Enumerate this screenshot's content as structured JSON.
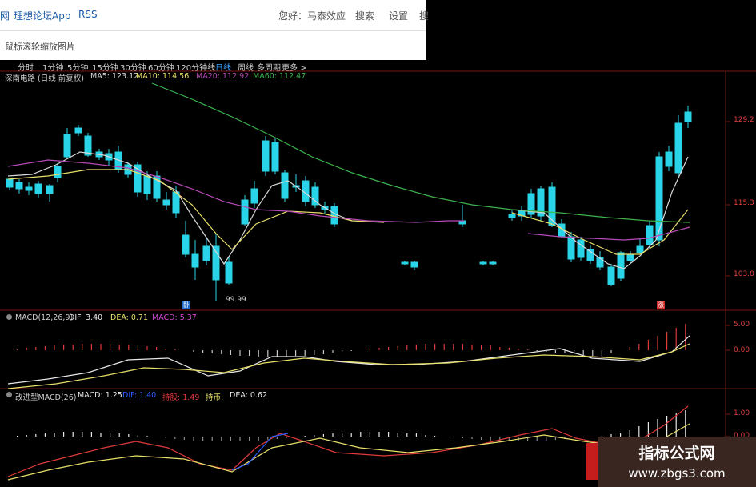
{
  "topbar": {
    "cut_left": "网",
    "forum_app": "理想论坛App",
    "rss": "RSS",
    "greeting": "您好：马泰效应",
    "search": "搜索",
    "settings": "设置",
    "cut_right": "搜"
  },
  "hint": "鼠标滚轮缩放图片",
  "periods": [
    "分时",
    "1分钟",
    "5分钟",
    "15分钟",
    "30分钟",
    "60分钟",
    "120分钟线",
    "日线",
    "周线",
    "多周期",
    "更多 >"
  ],
  "active_period": "日线",
  "ma": {
    "stock": "深南电路 (日线 前复权)",
    "ma5": "MA5: 123.12",
    "ma10": "MA10: 114.56",
    "ma20": "MA20: 112.92",
    "ma60": "MA60: 112.47",
    "arrow": "↑"
  },
  "price_ticks": [
    "129.2",
    "115.3",
    "103.8"
  ],
  "low_label": "99.99",
  "marker_left": "卧",
  "marker_right": "涨",
  "macd_panel": {
    "name": "MACD(12,26,9)",
    "dif": "DIF: 3.40",
    "dea": "DEA: 0.71",
    "macd": "MACD: 5.37",
    "ticks": [
      "5.00",
      "0.00"
    ]
  },
  "imp_panel": {
    "name": "改进型MACD(26)",
    "macd": "MACD: 1.25",
    "dif": "DIF: 1.40",
    "hold": "持股: 1.49",
    "coin": "持币:",
    "dea": "DEA: 0.62",
    "ticks": [
      "1.00",
      "0.00"
    ]
  },
  "watermark": {
    "title": "指标公式网",
    "url": "www.zbgs3.com"
  },
  "colors": {
    "up": "#e03a3a",
    "down": "#2ad4e8",
    "ma5": "#d8d8d8",
    "ma10": "#e8e06a",
    "ma20": "#b64ab6",
    "ma60": "#3db34f",
    "grid": "#7a1414"
  }
}
